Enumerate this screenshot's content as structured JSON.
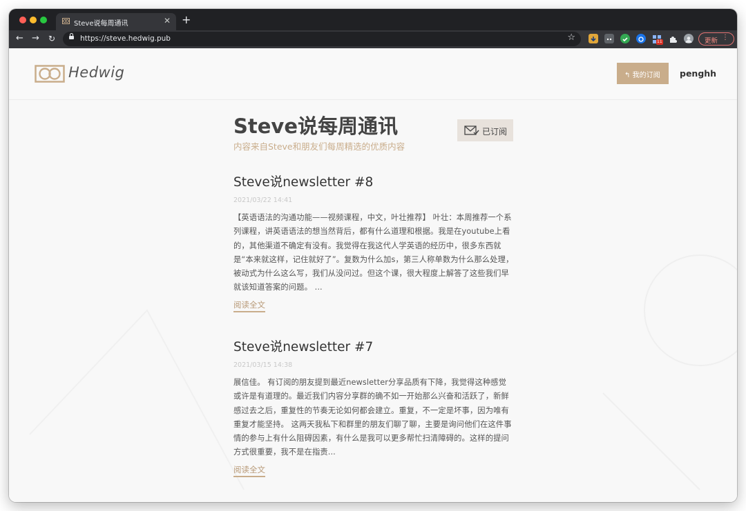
{
  "browser": {
    "tab": {
      "title": "Steve说每周通讯",
      "favicon": "hedwig-logo-icon"
    },
    "url": "https://steve.hedwig.pub",
    "update_button": {
      "label": "更新"
    },
    "extension_badge_count": "11"
  },
  "site": {
    "logo_text": "Hedwig",
    "my_subscriptions_label": "我的订阅",
    "username": "penghh"
  },
  "newsletter": {
    "title": "Steve说每周通讯",
    "subtitle": "内容来自Steve和朋友们每周精选的优质内容",
    "subscribed_label": "已订阅"
  },
  "posts": [
    {
      "title": "Steve说newsletter #8",
      "date": "2021/03/22 14:41",
      "excerpt": "【英语语法的沟通功能——视频课程，中文，叶壮推荐】 叶壮：本周推荐一个系列课程，讲英语语法的想当然背后，都有什么道理和根据。我是在youtube上看的，其他渠道不确定有没有。我觉得在我这代人学英语的经历中，很多东西就是“本来就这样，记住就好了”。复数为什么加s，第三人称单数为什么那么处理，被动式为什么这么写，我们从没问过。但这个课，很大程度上解答了这些我们早就该知道答案的问题。 ...",
      "read_more": "阅读全文"
    },
    {
      "title": "Steve说newsletter #7",
      "date": "2021/03/15 14:38",
      "excerpt": "展信佳。 有订阅的朋友提到最近newsletter分享品质有下降，我觉得这种感觉或许是有道理的。最近我们内容分享群的确不如一开始那么兴奋和活跃了，新鲜感过去之后，重复性的节奏无论如何都会建立。重复，不一定是坏事，因为唯有重复才能坚持。 这两天我私下和群里的朋友们聊了聊，主要是询问他们在这件事情的参与上有什么阻碍因素，有什么是我可以更多帮忙扫清障碍的。这样的提问方式很重要，我不是在指责...",
      "read_more": "阅读全文"
    }
  ],
  "colors": {
    "accent": "#c9ad8b",
    "accent_text": "#b89a78",
    "tab_strip": "#202124",
    "toolbar": "#35363a"
  }
}
